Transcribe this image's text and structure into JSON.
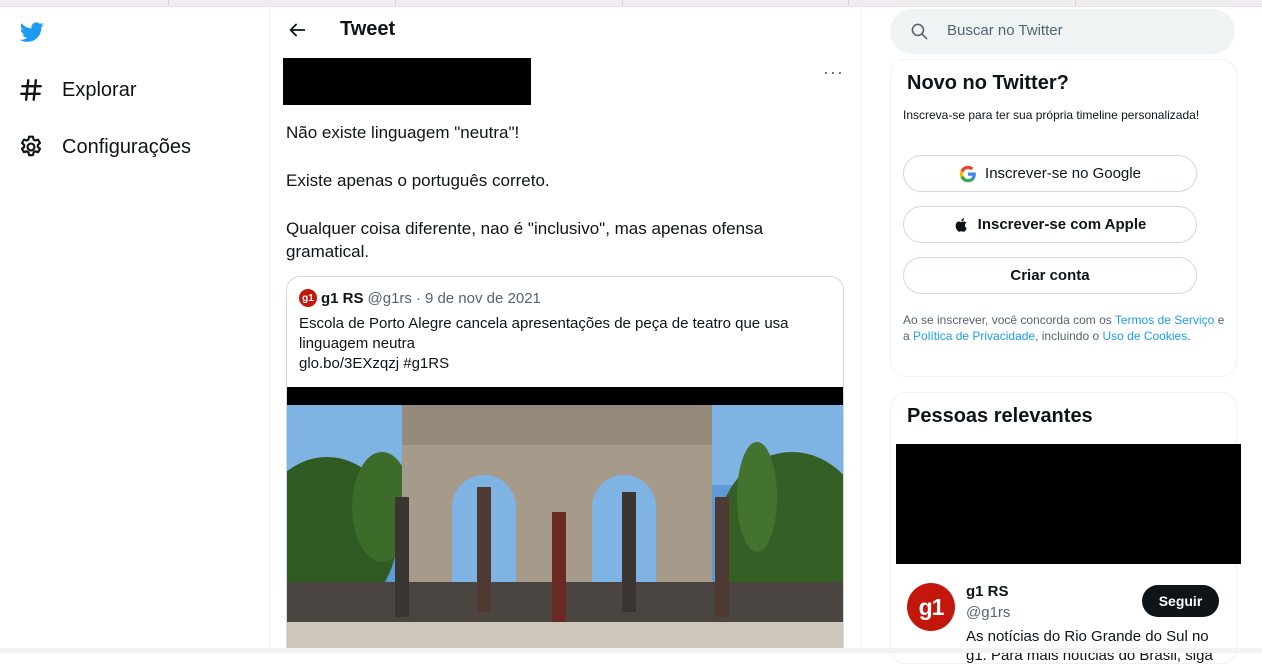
{
  "colors": {
    "accent": "#1d9bf0",
    "brand_g1": "#c4170c",
    "text_secondary": "#536471"
  },
  "nav": {
    "items": [
      {
        "label": "Explorar",
        "icon": "hashtag-icon"
      },
      {
        "label": "Configurações",
        "icon": "gear-icon"
      }
    ]
  },
  "header": {
    "title": "Tweet"
  },
  "tweet": {
    "more_label": "···",
    "paragraphs": [
      "Não existe linguagem \"neutra\"!",
      "Existe apenas o português correto.",
      "Qualquer coisa diferente, nao é \"inclusivo\", mas apenas ofensa gramatical."
    ],
    "quote": {
      "badge": "g1",
      "name": "g1 RS",
      "handle": "@g1rs",
      "sep": "·",
      "date": "9 de nov de 2021",
      "text": "Escola de Porto Alegre cancela apresentações de peça de teatro que usa linguagem neutra",
      "link": "glo.bo/3EXzqzj #g1RS"
    }
  },
  "search": {
    "placeholder": "Buscar no Twitter"
  },
  "signup": {
    "title": "Novo no Twitter?",
    "subtitle": "Inscreva-se para ter sua própria timeline personalizada!",
    "google_label": "Inscrever-se no Google",
    "apple_label": "Inscrever-se com Apple",
    "create_label": "Criar conta",
    "legal": {
      "prefix": "Ao se inscrever, você concorda com os ",
      "terms": "Termos de Serviço",
      "mid1": " e a ",
      "privacy": "Política de Privacidade",
      "mid2": ", incluindo o ",
      "cookies": "Uso de Cookies",
      "suffix": "."
    }
  },
  "relevant": {
    "title": "Pessoas relevantes",
    "account": {
      "logo": "g1",
      "name": "g1 RS",
      "handle": "@g1rs",
      "follow_label": "Seguir",
      "bio": "As notícias do Rio Grande do Sul no",
      "bio2": "g1. Para mais notícias do Brasil, siga"
    }
  }
}
